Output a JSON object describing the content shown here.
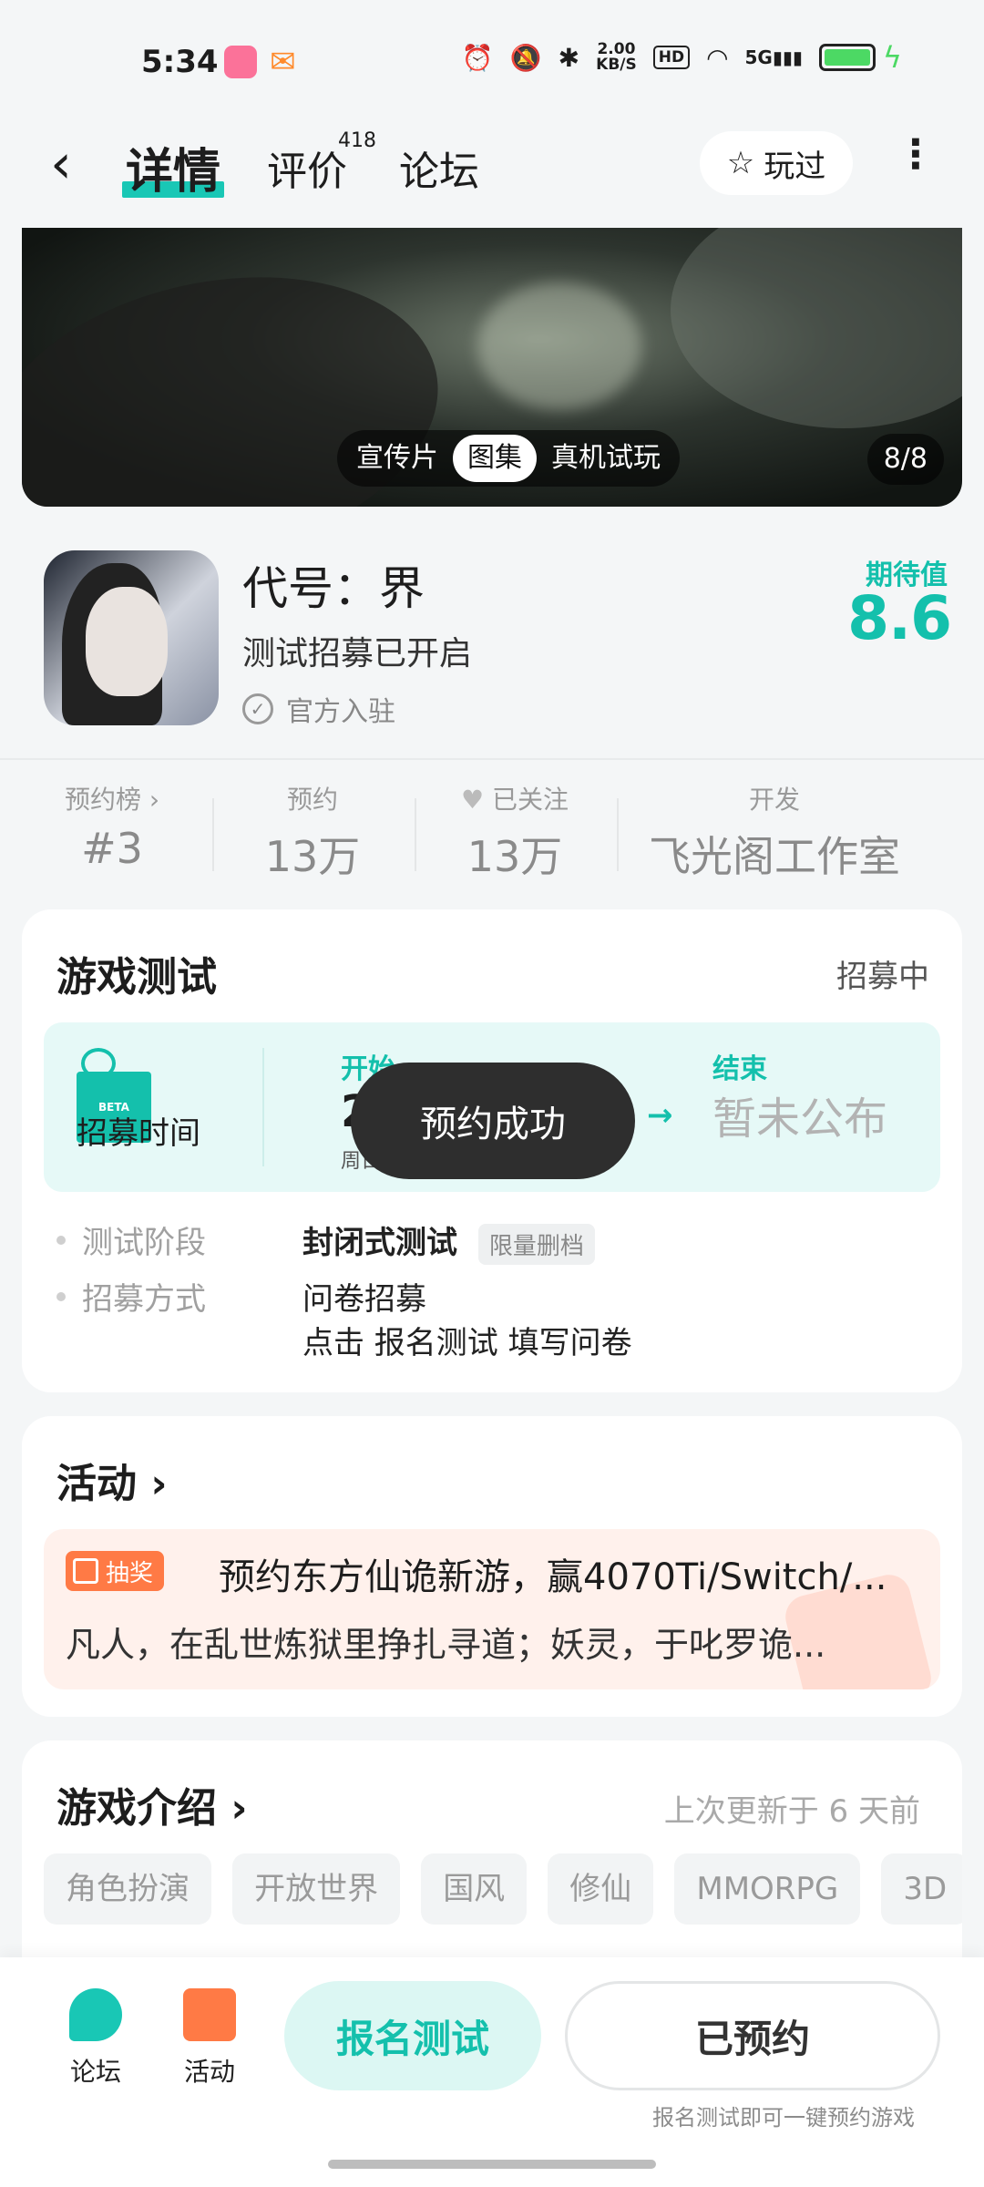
{
  "status_bar": {
    "time": "5:34",
    "speed_value": "2.00",
    "speed_unit": "KB/S",
    "hd": "HD",
    "network": "5G",
    "icons": [
      "bilibili-app-icon",
      "chat-app-icon",
      "alarm-icon",
      "mute-icon",
      "bluetooth-icon",
      "wifi-icon",
      "signal-icon",
      "battery-icon",
      "charging-icon"
    ]
  },
  "nav": {
    "tabs": [
      {
        "label": "详情",
        "active": true
      },
      {
        "label": "评价",
        "badge": "418"
      },
      {
        "label": "论坛"
      }
    ],
    "played_label": "玩过"
  },
  "banner": {
    "media_tabs": [
      "宣传片",
      "图集",
      "真机试玩"
    ],
    "active_tab": "图集",
    "counter": "8/8"
  },
  "game": {
    "name": "代号：界",
    "subtitle": "测试招募已开启",
    "official": "官方入驻",
    "expect_label": "期待值",
    "expect_score": "8.6"
  },
  "stats": [
    {
      "label": "预约榜 ›",
      "value": "#3"
    },
    {
      "label": "预约",
      "value": "13万"
    },
    {
      "label": "已关注",
      "value": "13万"
    },
    {
      "label": "开发",
      "value": "飞光阁工作室"
    }
  ],
  "game_test": {
    "title": "游戏测试",
    "status": "招募中",
    "recruit_time_label": "招募时间",
    "beta_tag": "BETA",
    "start_label": "开始",
    "start_value": "2",
    "start_day": "周日",
    "end_label": "结束",
    "end_value": "暂未公布",
    "toast": "预约成功",
    "stage_label": "测试阶段",
    "stage_value": "封闭式测试",
    "stage_tag": "限量删档",
    "method_label": "招募方式",
    "method_value": "问卷招募",
    "method_detail": "点击 报名测试 填写问卷"
  },
  "activity": {
    "title": "活动 ›",
    "badge": "抽奖",
    "item_title": "预约东方仙诡新游，赢4070Ti/Switch/...",
    "item_desc": "凡人，在乱世炼狱里挣扎寻道；妖灵，于叱罗诡..."
  },
  "intro": {
    "title": "游戏介绍 ›",
    "updated": "上次更新于 6 天前",
    "tags": [
      "角色扮演",
      "开放世界",
      "国风",
      "修仙",
      "MMORPG",
      "3D"
    ]
  },
  "bottom_bar": {
    "forum_label": "论坛",
    "activity_label": "活动",
    "signup_label": "报名测试",
    "reserved_label": "已预约",
    "hint": "报名测试即可一键预约游戏"
  },
  "colors": {
    "accent": "#14c0ac",
    "lottery": "#ff7a45",
    "toast_bg": "#2e2e2e"
  }
}
